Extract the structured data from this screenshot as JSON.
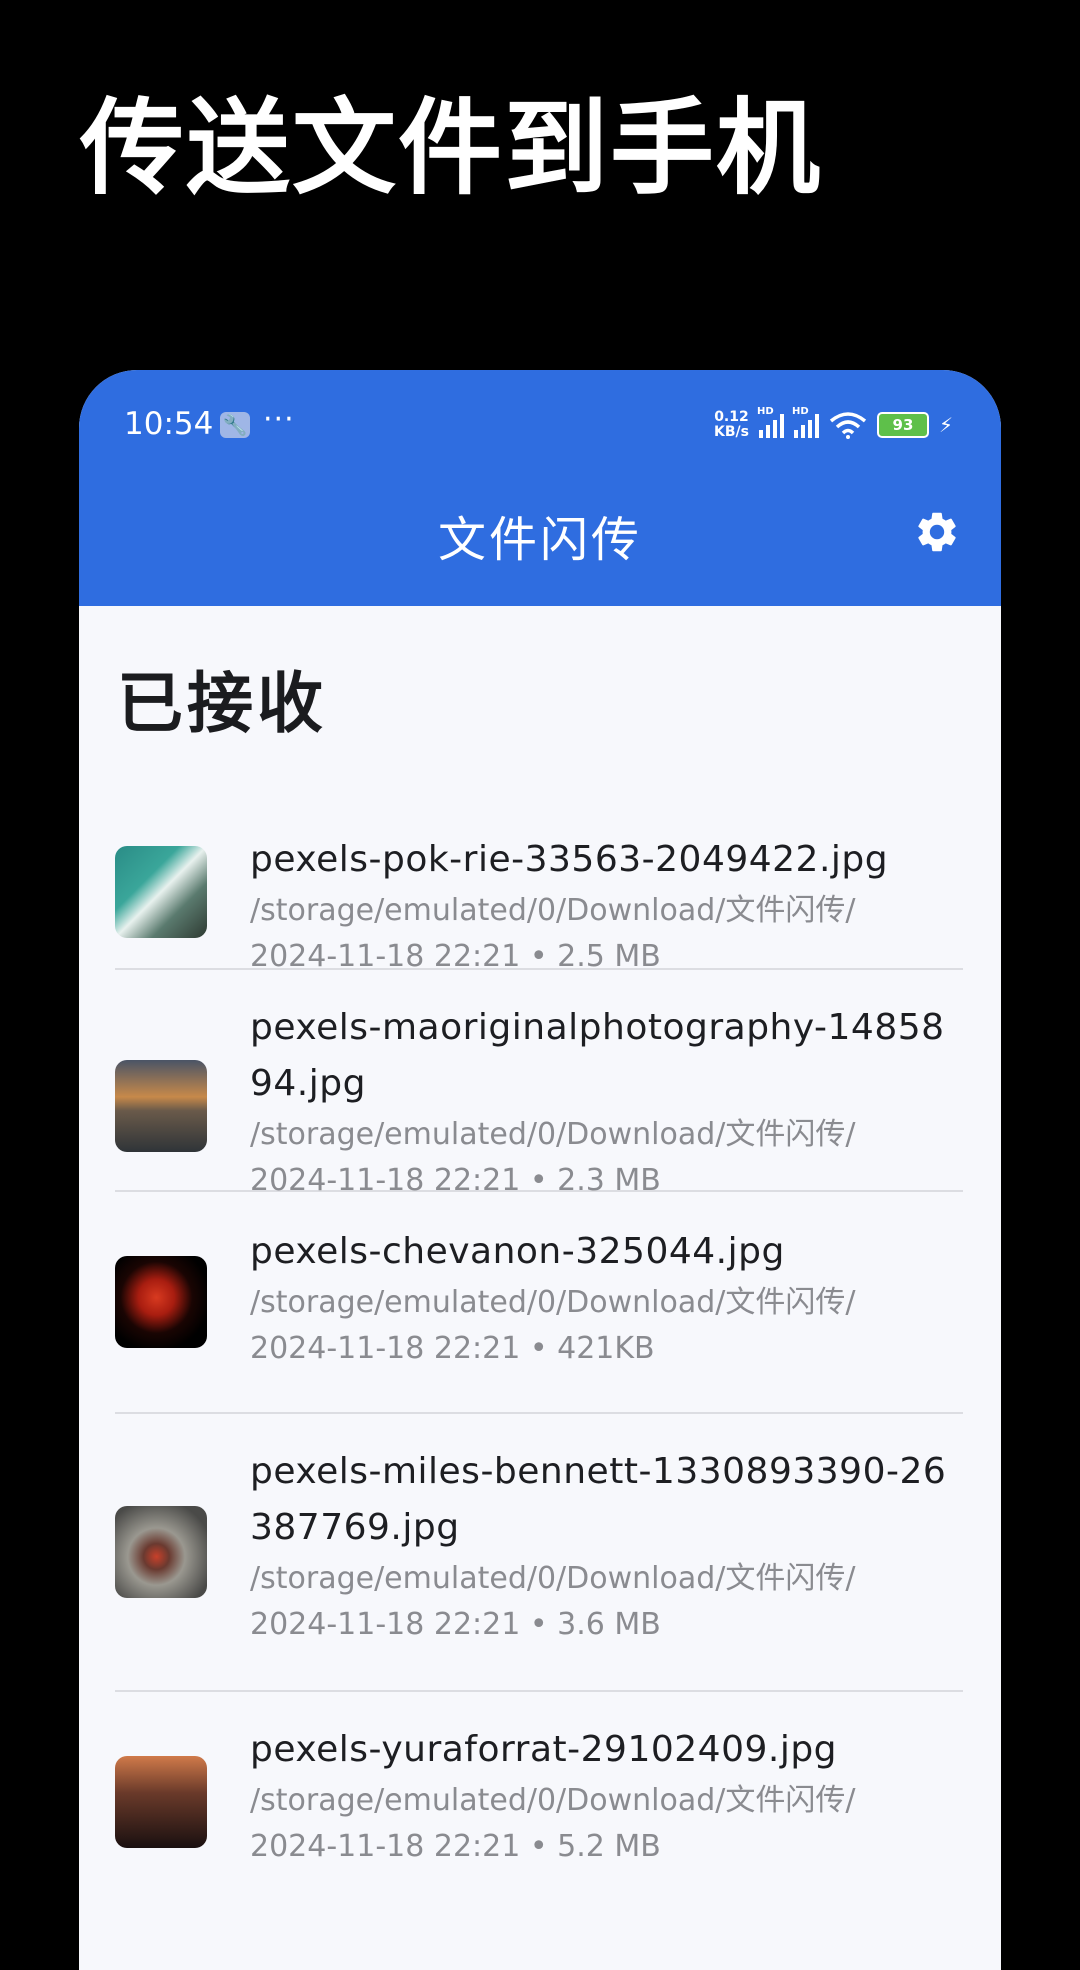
{
  "promo": {
    "headline": "传送文件到手机"
  },
  "status_bar": {
    "time": "10:54",
    "dots": "···",
    "net_speed_value": "0.12",
    "net_speed_unit": "KB/s",
    "hd1": "HD",
    "hd2": "HD",
    "battery": "93"
  },
  "appbar": {
    "title": "文件闪传",
    "settings_icon": "gear-icon"
  },
  "section": {
    "title": "已接收"
  },
  "files": [
    {
      "name": "pexels-pok-rie-33563-2049422.jpg",
      "path": "/storage/emulated/0/Download/文件闪传/",
      "meta": "2024-11-18 22:21  •  2.5 MB"
    },
    {
      "name": "pexels-maoriginalphotography-1485894.jpg",
      "path": "/storage/emulated/0/Download/文件闪传/",
      "meta": "2024-11-18 22:21  •  2.3 MB"
    },
    {
      "name": "pexels-chevanon-325044.jpg",
      "path": "/storage/emulated/0/Download/文件闪传/",
      "meta": "2024-11-18 22:21  •  421KB"
    },
    {
      "name": "pexels-miles-bennett-1330893390-26387769.jpg",
      "path": "/storage/emulated/0/Download/文件闪传/",
      "meta": "2024-11-18 22:21  •  3.6 MB"
    },
    {
      "name": "pexels-yuraforrat-29102409.jpg",
      "path": "/storage/emulated/0/Download/文件闪传/",
      "meta": "2024-11-18 22:21  •  5.2 MB"
    }
  ],
  "colors": {
    "appbar": "#2f6de0",
    "background": "#f7f8fc"
  }
}
